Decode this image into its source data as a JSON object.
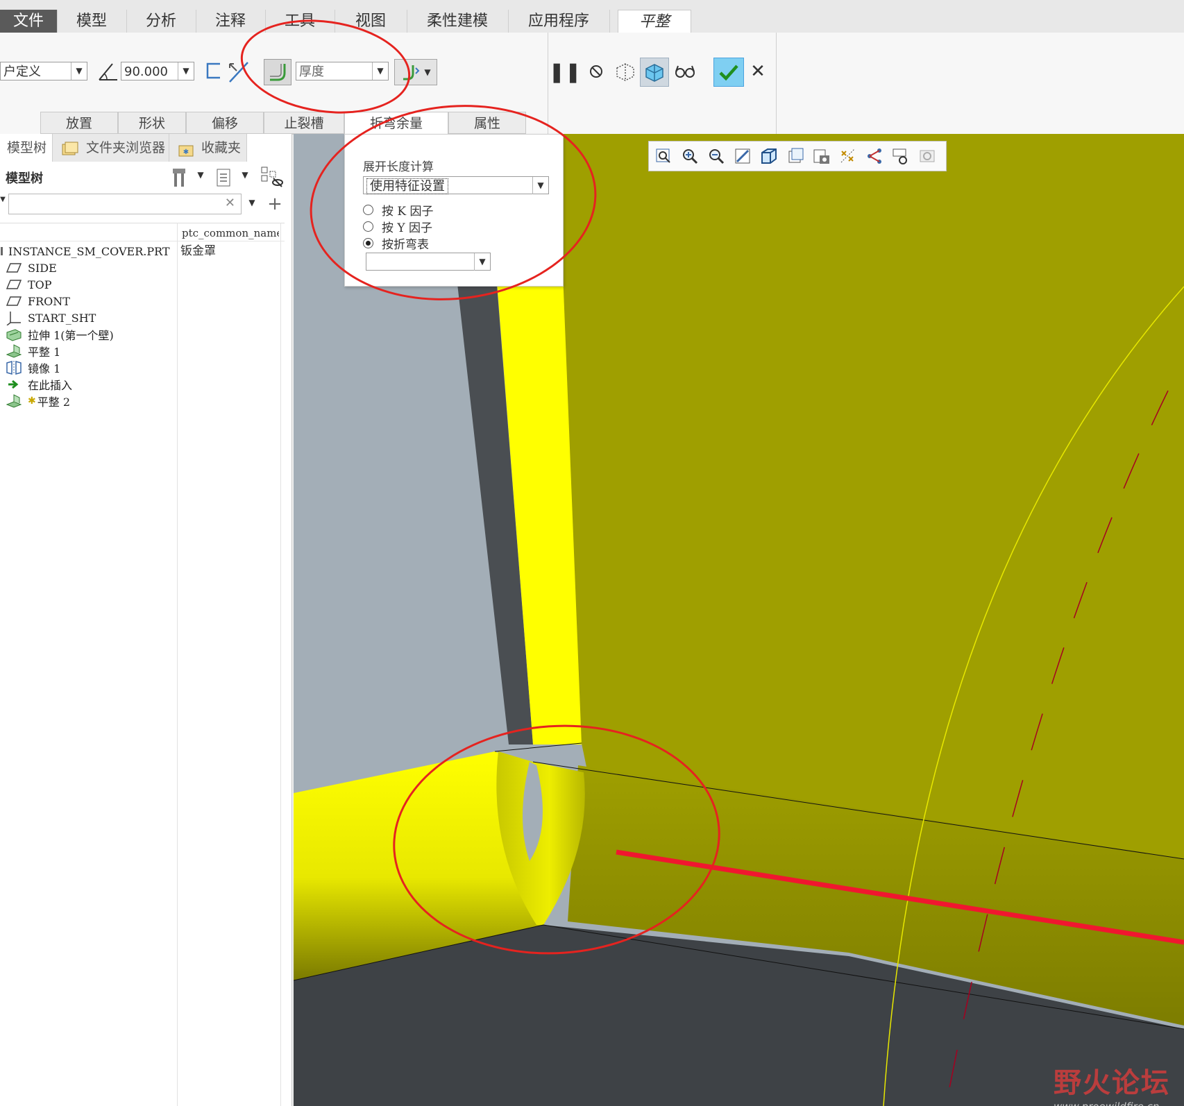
{
  "menu": {
    "tabs": [
      "文件",
      "模型",
      "分析",
      "注释",
      "工具",
      "视图",
      "柔性建模",
      "应用程序",
      "平整"
    ],
    "active_tab": "平整"
  },
  "ribbon": {
    "type_combo": "户定义",
    "angle_value": "90.000",
    "thickness_combo": "厚度",
    "subtabs": [
      "放置",
      "形状",
      "偏移",
      "止裂槽",
      "折弯余量",
      "属性"
    ],
    "active_subtab": "折弯余量",
    "accent": "#4aa3df",
    "ok_color": "#2e9e2e"
  },
  "bend_panel": {
    "section_label": "展开长度计算",
    "dropdown_value": "使用特征设置",
    "options": [
      "按 K 因子",
      "按 Y 因子",
      "按折弯表"
    ],
    "selected_option": 2,
    "table_dropdown_value": ""
  },
  "left_panel": {
    "tabs": [
      "模型树",
      "文件夹浏览器",
      "收藏夹"
    ],
    "header": "模型树",
    "search_placeholder": "",
    "column_header": "ptc_common_name",
    "items": [
      {
        "label": "INSTANCE_SM_COVER.PRT",
        "value": "钣金罩",
        "icon": "part-icon"
      },
      {
        "label": "SIDE",
        "value": "",
        "icon": "datum-plane-icon"
      },
      {
        "label": "TOP",
        "value": "",
        "icon": "datum-plane-icon"
      },
      {
        "label": "FRONT",
        "value": "",
        "icon": "datum-plane-icon"
      },
      {
        "label": "START_SHT",
        "value": "",
        "icon": "csys-icon"
      },
      {
        "label": "拉伸 1(第一个壁)",
        "value": "",
        "icon": "extrude-icon"
      },
      {
        "label": "平整 1",
        "value": "",
        "icon": "flat-wall-icon"
      },
      {
        "label": "镜像 1",
        "value": "",
        "icon": "mirror-icon"
      },
      {
        "label": "在此插入",
        "value": "",
        "icon": "insert-here-icon"
      },
      {
        "label": "平整 2",
        "value": "",
        "icon": "flat-wall-new-icon"
      }
    ]
  },
  "watermark": {
    "title": "野火论坛",
    "url": "www.proewildfire.cn"
  },
  "colors": {
    "model_yellow": "#ffff00",
    "model_olive": "#9f9f00",
    "model_dark": "#3e4246",
    "background": "#a3aeb7",
    "annotation": "#e5231f"
  }
}
